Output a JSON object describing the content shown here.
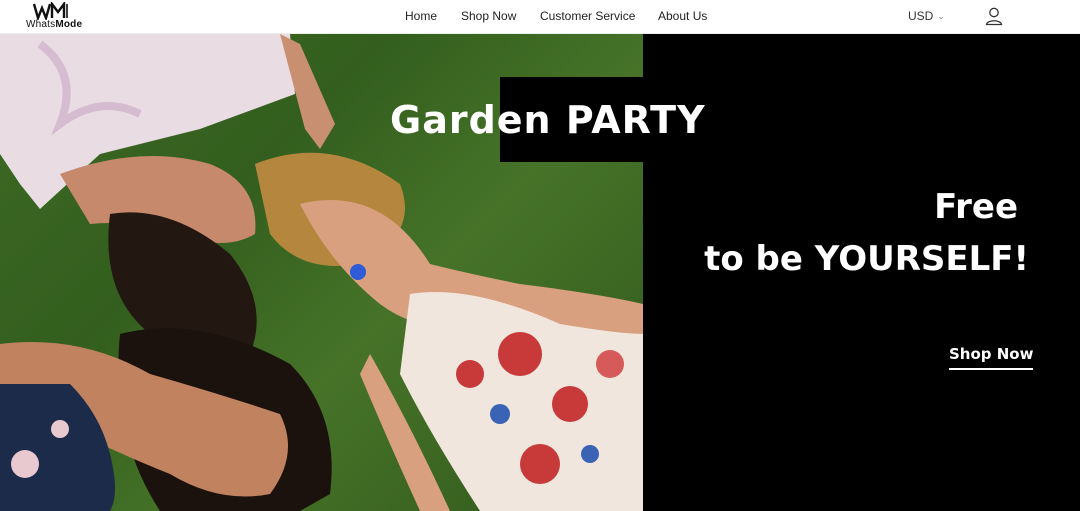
{
  "brand": {
    "name_prefix": "Whats",
    "name_suffix": "Mode",
    "logo_mark": "WM"
  },
  "nav": {
    "items": [
      {
        "label": "Home"
      },
      {
        "label": "Shop Now"
      },
      {
        "label": "Customer Service"
      },
      {
        "label": "About Us"
      }
    ]
  },
  "header": {
    "currency": "USD",
    "currency_icon": "chevron-down-icon",
    "account_icon": "user-icon"
  },
  "hero": {
    "title": "Garden PARTY",
    "tagline_line1": "Free",
    "tagline_line2_prefix": "to be ",
    "tagline_line2_emphasis": "YOURSELF!",
    "cta_label": "Shop Now",
    "image": "women-lying-on-grass-photo"
  },
  "colors": {
    "panel": "#000000",
    "text_on_panel": "#ffffff",
    "grass": "#3f6b25"
  }
}
